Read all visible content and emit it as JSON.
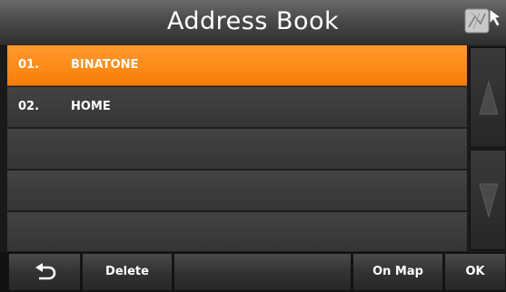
{
  "header": {
    "title": "Address Book",
    "map_icon": "map-cursor-icon"
  },
  "list": {
    "items": [
      {
        "number": "01.",
        "name": "BINATONE",
        "selected": true
      },
      {
        "number": "02.",
        "name": "HOME",
        "selected": false
      },
      {
        "number": "",
        "name": "",
        "selected": false
      },
      {
        "number": "",
        "name": "",
        "selected": false
      },
      {
        "number": "",
        "name": "",
        "selected": false
      }
    ]
  },
  "scrollbar": {
    "up_icon": "triangle-up-icon",
    "down_icon": "triangle-down-icon"
  },
  "toolbar": {
    "back_icon": "back-arrow-icon",
    "delete_label": "Delete",
    "on_map_label": "On Map",
    "ok_label": "OK"
  },
  "colors": {
    "accent": "#ff8c1a",
    "text": "#ffffff",
    "row": "#3c3c3c"
  }
}
